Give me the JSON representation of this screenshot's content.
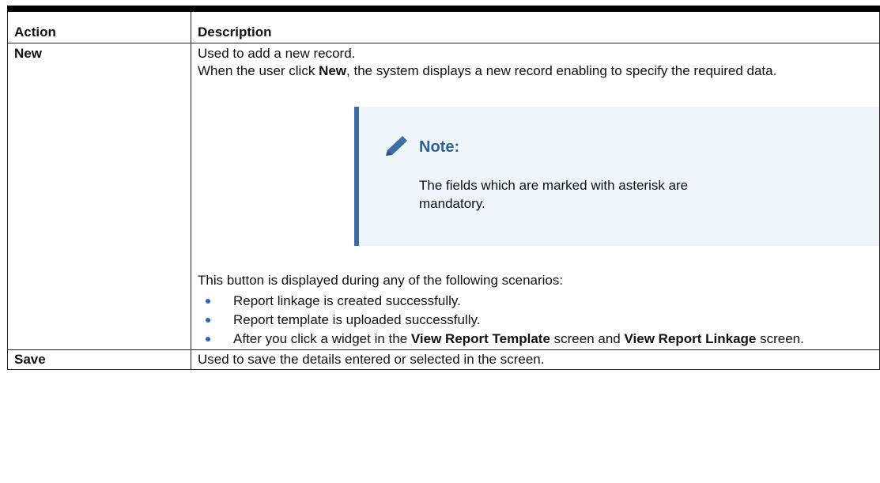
{
  "table": {
    "headers": {
      "action": "Action",
      "description": "Description"
    },
    "rows": [
      {
        "action": "New",
        "desc_line1": "Used to add a new record.",
        "desc_line2_pre": "When the user click ",
        "desc_line2_bold": "New",
        "desc_line2_post": ", the system displays a new record enabling to specify the required data.",
        "note": {
          "title": "Note:",
          "text": "The fields which are marked with asterisk are mandatory."
        },
        "scenario_intro": "This button is displayed during any of the following scenarios:",
        "bullets": [
          {
            "text": "Report linkage is created successfully."
          },
          {
            "text": "Report template is uploaded successfully."
          },
          {
            "pre": "After you click a widget in the ",
            "bold1": "View Report Template",
            "mid": " screen and ",
            "bold2": "View Report Linkage",
            "post": " screen."
          }
        ]
      },
      {
        "action": "Save",
        "description": "Used to save the details entered or selected in the screen."
      }
    ]
  },
  "colors": {
    "note_accent": "#3c6ea5",
    "note_background": "#eef5fb",
    "note_title": "#2f5f9a",
    "bullet": "#2f6ab0"
  },
  "icons": {
    "note": "pencil-icon",
    "bullet": "bullet-dot-icon"
  }
}
